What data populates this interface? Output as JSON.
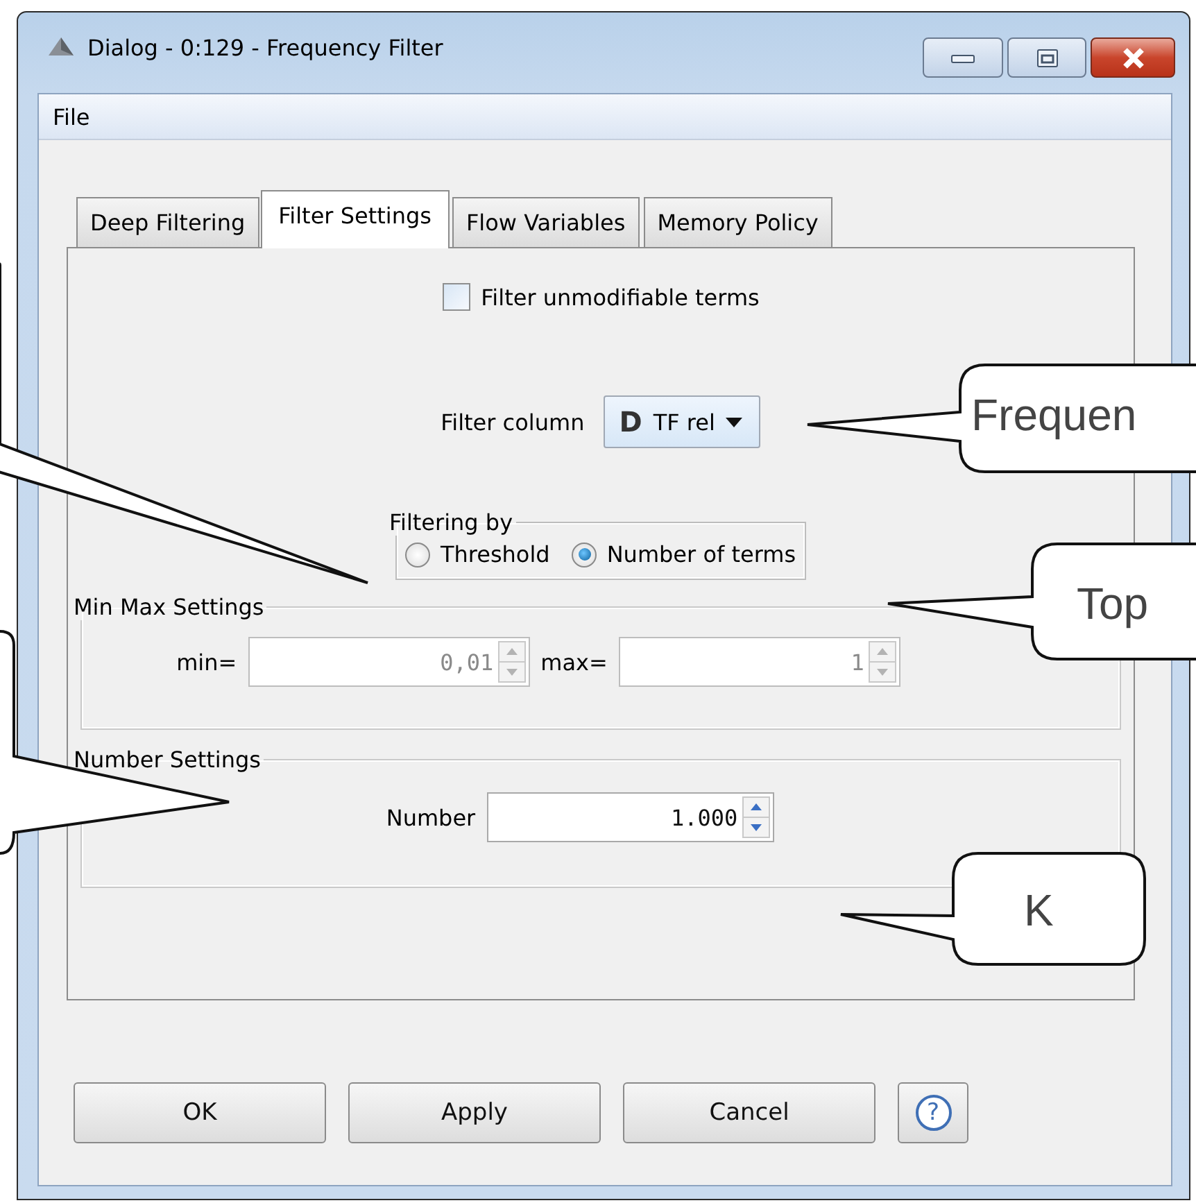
{
  "window": {
    "title": "Dialog - 0:129 - Frequency Filter"
  },
  "menu": [
    "File"
  ],
  "tabs": [
    {
      "label": "Deep Filtering",
      "selected": false
    },
    {
      "label": "Filter Settings",
      "selected": true
    },
    {
      "label": "Flow Variables",
      "selected": false
    },
    {
      "label": "Memory Policy",
      "selected": false
    }
  ],
  "filter_unmodifiable": {
    "label": "Filter unmodifiable terms",
    "checked": false
  },
  "filter_column": {
    "label": "Filter column",
    "type_letter": "D",
    "value": "TF rel"
  },
  "filtering_by": {
    "title": "Filtering by",
    "options": [
      {
        "label": "Threshold",
        "selected": false
      },
      {
        "label": "Number of terms",
        "selected": true
      }
    ]
  },
  "min_max": {
    "title": "Min Max Settings",
    "disabled": true,
    "fields": [
      {
        "label": "min=",
        "value": "0,01"
      },
      {
        "label": "max=",
        "value": "1"
      }
    ]
  },
  "number_settings": {
    "title": "Number Settings",
    "disabled": false,
    "fields": [
      {
        "label": "Number",
        "value": "1.000"
      }
    ]
  },
  "buttons": [
    {
      "label": "OK",
      "kind": "text"
    },
    {
      "label": "Apply",
      "kind": "text"
    },
    {
      "label": "Cancel",
      "kind": "text"
    },
    {
      "label": "?",
      "kind": "help"
    }
  ],
  "callouts": [
    {
      "kind": "blank"
    },
    {
      "kind": "blank"
    },
    {
      "kind": "text",
      "text": "Frequen"
    },
    {
      "kind": "text",
      "text": "Top"
    },
    {
      "kind": "text",
      "text": "K"
    }
  ]
}
